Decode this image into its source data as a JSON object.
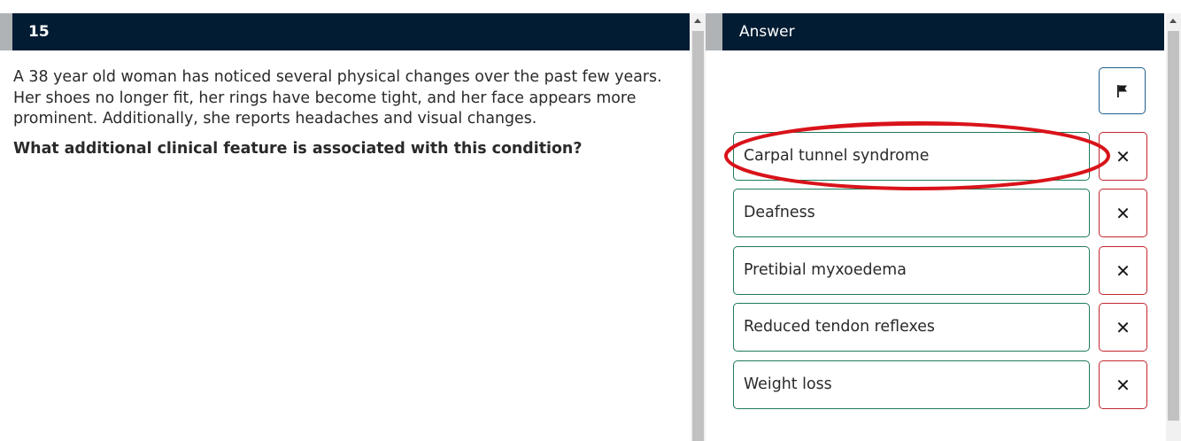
{
  "question": {
    "number": "15",
    "stem": "A 38 year old woman has noticed several physical changes over the past few years. Her shoes no longer fit, her rings have become tight, and her face appears more prominent. Additionally, she reports headaches and visual changes.",
    "prompt": "What additional clinical feature is associated with this condition?"
  },
  "answer_panel": {
    "title": "Answer",
    "flag_icon": "flag-icon",
    "strike_icon": "close-icon",
    "strike_glyph": "✕",
    "options": [
      {
        "label": "Carpal tunnel syndrome",
        "circled": true
      },
      {
        "label": "Deafness"
      },
      {
        "label": "Pretibial myxoedema"
      },
      {
        "label": "Reduced tendon reflexes"
      },
      {
        "label": "Weight loss"
      }
    ]
  },
  "colors": {
    "header_bg": "#021c33",
    "option_border": "#1e7a5c",
    "strike_border": "#c4262e",
    "flag_border": "#1f5f8b",
    "annotation": "#d9131a"
  }
}
